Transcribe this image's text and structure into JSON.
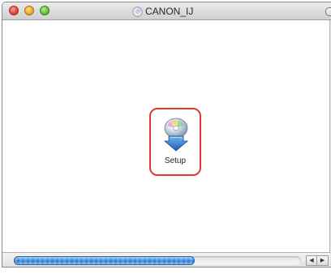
{
  "window": {
    "title": "CANON_IJ",
    "title_icon": "cd-disc-icon"
  },
  "traffic_lights": {
    "close": {
      "glyph": "",
      "color": "#e0443a"
    },
    "minimize": {
      "glyph": "",
      "color": "#e9a92a"
    },
    "zoom": {
      "glyph": "",
      "color": "#5fbf3a"
    }
  },
  "items": [
    {
      "label": "Setup",
      "icon": "installer-disc-icon",
      "highlight_color": "#e23a2e"
    }
  ],
  "scrollbar": {
    "horizontal_position_fraction": 0.63,
    "left_arrow": "◀",
    "right_arrow": "▶",
    "accent": "#3b8ee0"
  }
}
